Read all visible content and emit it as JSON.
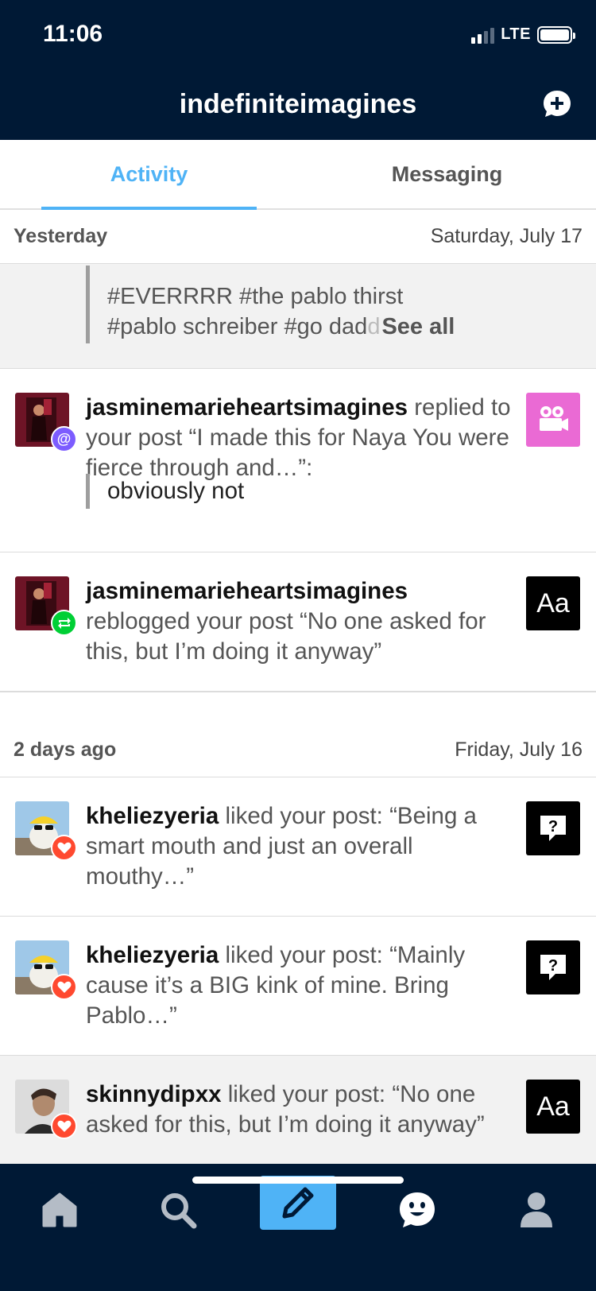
{
  "status_bar": {
    "time": "11:06",
    "network": "LTE"
  },
  "header": {
    "title": "indefiniteimagines"
  },
  "tabs": [
    {
      "label": "Activity",
      "active": true
    },
    {
      "label": "Messaging",
      "active": false
    }
  ],
  "sections": [
    {
      "relative": "Yesterday",
      "date": "Saturday, July 17",
      "tag_preview": {
        "line1": "#EVERRRR #the pablo thirst",
        "line2_visible": "#pablo schreiber #go dad",
        "line2_faded": "d",
        "see_all": "See all"
      },
      "items": [
        {
          "user": "jasminemarieheartsimagines",
          "action": " replied to your post “I made this for Naya You were fierce through and…”:",
          "reply": "obviously not",
          "badge": "mention",
          "thumb": "video"
        },
        {
          "user": "jasminemarieheartsimagines",
          "action": " reblogged your post “No one asked for this, but I’m doing it anyway”",
          "badge": "reblog",
          "thumb_text": "Aa"
        }
      ]
    },
    {
      "relative": "2 days ago",
      "date": "Friday, July 16",
      "items": [
        {
          "user": "kheliezyeria",
          "action": " liked your post: “Being a smart mouth and just an overall mouthy…”",
          "badge": "like",
          "thumb": "ask"
        },
        {
          "user": "kheliezyeria",
          "action": " liked your post: “Mainly cause it’s a BIG kink of mine. Bring Pablo…”",
          "badge": "like",
          "thumb": "ask"
        },
        {
          "user": "skinnydipxx",
          "action": " liked your post: “No one asked for this, but I’m doing it anyway”",
          "badge": "like",
          "thumb_text": "Aa"
        }
      ]
    }
  ],
  "colors": {
    "navy": "#001935",
    "accent_blue": "#4fb3f6",
    "mention_badge": "#7c5cff",
    "reblog_badge": "#00cf35",
    "like_badge": "#ff492f",
    "video_thumb": "#ea6ad4"
  },
  "bottom_nav": [
    "home-icon",
    "search-icon",
    "compose-icon",
    "activity-icon",
    "account-icon"
  ]
}
